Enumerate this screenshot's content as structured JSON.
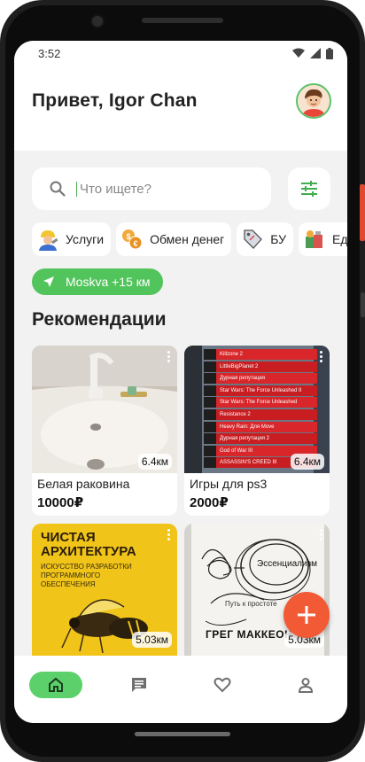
{
  "status_bar": {
    "time": "3:52"
  },
  "header": {
    "greeting": "Привет, Igor Chan"
  },
  "search": {
    "placeholder": "Что ищете?"
  },
  "categories": [
    {
      "label": "Услуги",
      "icon": "worker-icon"
    },
    {
      "label": "Обмен денег",
      "icon": "money-exchange-icon"
    },
    {
      "label": "БУ",
      "icon": "price-tag-icon"
    },
    {
      "label": "Ед",
      "icon": "food-icon"
    }
  ],
  "location": {
    "label": "Moskva +15 км"
  },
  "section_title": "Рекомендации",
  "listings": [
    {
      "title": "Белая раковина",
      "price": "10000₽",
      "distance": "6.4км"
    },
    {
      "title": "Игры для ps3",
      "price": "2000₽",
      "distance": "6.4км"
    },
    {
      "title": "",
      "price": "",
      "distance": "5.03км",
      "cover_text": [
        "ЧИСТАЯ",
        "АРХИТЕКТУРА"
      ],
      "cover_sub": "ИСКУССТВО РАЗРАБОТКИ ПРОГРАММНОГО ОБЕСПЕЧЕНИЯ"
    },
    {
      "title": "",
      "price": "",
      "distance": "5.03км",
      "cover_text": [
        "Эссенциализм"
      ],
      "cover_sub": "Путь к простоте",
      "author": "ГРЕГ МАККЕОН"
    }
  ],
  "ps3_games": [
    "Killzone 2",
    "LittleBigPlanet 2",
    "Дурная репутация",
    "Star Wars: The Force Unleashed II",
    "Star Wars: The Force Unleashed",
    "Resistance 2",
    "Heavy Rain: Для Move",
    "Дурная репутация 2",
    "God of War III",
    "ASSASSIN'S CREED III"
  ],
  "bottom_nav": [
    {
      "name": "home",
      "icon": "home-icon",
      "active": true
    },
    {
      "name": "messages",
      "icon": "chat-icon",
      "active": false
    },
    {
      "name": "favorites",
      "icon": "heart-icon",
      "active": false
    },
    {
      "name": "profile",
      "icon": "person-icon",
      "active": false
    }
  ],
  "colors": {
    "accent_green": "#52c45c",
    "fab_orange": "#f25a35",
    "background": "#f2f2f2"
  }
}
